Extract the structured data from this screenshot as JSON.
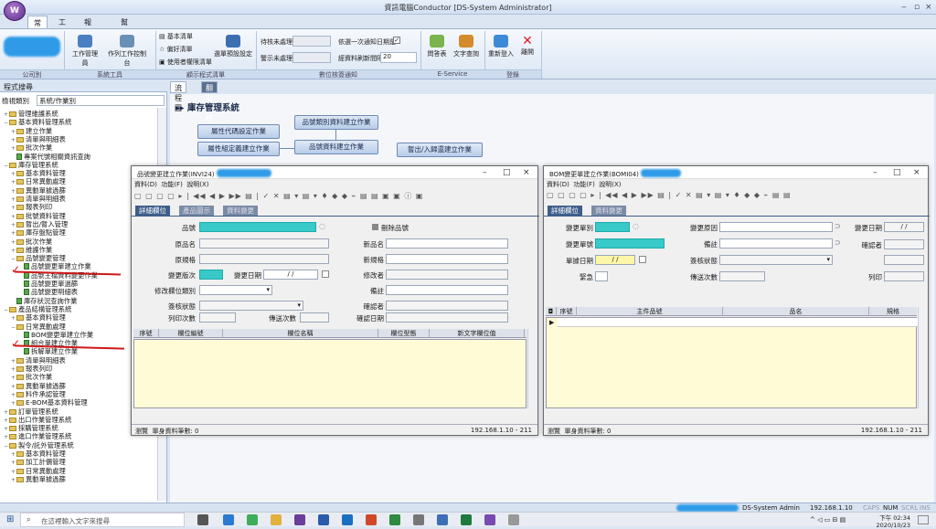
{
  "app": {
    "title": "資訊電腦Conductor [DS-System Administrator]",
    "orb": "W"
  },
  "ribbon": {
    "tabs": [
      "常用",
      "工具",
      "報告處理",
      "幫助"
    ],
    "groups": {
      "company": "公司別",
      "system_tools": "系統工具",
      "favorites": "顧示程式清單",
      "notify": "數位核簽通知",
      "eservice": "E-Service",
      "login": "登錄"
    },
    "buttons": {
      "work_manage": "工作管理員",
      "exec_console": "作列工作控制台",
      "basic_list": "基本清單",
      "my_favorites": "偏好清單",
      "user_auth": "使用者權限清單",
      "menu_setting": "選單預設設定",
      "approval_count": "待核未處理",
      "notify_count": "警示未處理",
      "reminder": "依選一次通知日期是",
      "refresh_interval": "經資料刷新間隔",
      "interval_value": "20",
      "q_and_a": "問答表",
      "doc_search": "文字查詢",
      "relogin": "重新登入",
      "close": "離開"
    }
  },
  "sidebar": {
    "title": "程式搜尋",
    "filter_label": "檢視類別",
    "filter_value": "系統/作業別",
    "tree": [
      {
        "t": "管理維護系統",
        "lvl": 1,
        "k": "fold",
        "e": "+"
      },
      {
        "t": "基本資料管理系統",
        "lvl": 1,
        "k": "fold",
        "e": "−"
      },
      {
        "t": "建立作業",
        "lvl": 2,
        "k": "fold",
        "e": "+"
      },
      {
        "t": "清單與明細表",
        "lvl": 2,
        "k": "fold",
        "e": "+"
      },
      {
        "t": "批次作業",
        "lvl": 2,
        "k": "fold",
        "e": "+"
      },
      {
        "t": "專案代號相關資訊查詢",
        "lvl": 2,
        "k": "doc",
        "e": ""
      },
      {
        "t": "庫存管理系統",
        "lvl": 1,
        "k": "fold",
        "e": "−"
      },
      {
        "t": "基本資料管理",
        "lvl": 2,
        "k": "fold",
        "e": "+"
      },
      {
        "t": "日常異動處理",
        "lvl": 2,
        "k": "fold",
        "e": "+"
      },
      {
        "t": "異動單據過篩",
        "lvl": 2,
        "k": "fold",
        "e": "+"
      },
      {
        "t": "清單與明細表",
        "lvl": 2,
        "k": "fold",
        "e": "+"
      },
      {
        "t": "報表列印",
        "lvl": 2,
        "k": "fold",
        "e": "+"
      },
      {
        "t": "批號資料管理",
        "lvl": 2,
        "k": "fold",
        "e": "+"
      },
      {
        "t": "暫出/暫入管理",
        "lvl": 2,
        "k": "fold",
        "e": "+"
      },
      {
        "t": "庫存盤點管理",
        "lvl": 2,
        "k": "fold",
        "e": "+"
      },
      {
        "t": "批次作業",
        "lvl": 2,
        "k": "fold",
        "e": "+"
      },
      {
        "t": "維護作業",
        "lvl": 2,
        "k": "fold",
        "e": "+"
      },
      {
        "t": "品號變更管理",
        "lvl": 2,
        "k": "fold",
        "e": "−"
      },
      {
        "t": "品號變更單建立作業",
        "lvl": 3,
        "k": "doc",
        "e": ""
      },
      {
        "t": "品號主檔資料變更作業",
        "lvl": 3,
        "k": "doc",
        "e": ""
      },
      {
        "t": "品號變更單過篩",
        "lvl": 3,
        "k": "doc",
        "e": ""
      },
      {
        "t": "品號變更明細表",
        "lvl": 3,
        "k": "doc",
        "e": ""
      },
      {
        "t": "庫存狀況查詢作業",
        "lvl": 2,
        "k": "doc",
        "e": ""
      },
      {
        "t": "產品結構管理系統",
        "lvl": 1,
        "k": "fold",
        "e": "−"
      },
      {
        "t": "基本資料管理",
        "lvl": 2,
        "k": "fold",
        "e": "+"
      },
      {
        "t": "日常異動處理",
        "lvl": 2,
        "k": "fold",
        "e": "−"
      },
      {
        "t": "BOM變更單建立作業",
        "lvl": 3,
        "k": "doc",
        "e": ""
      },
      {
        "t": "組合單建立作業",
        "lvl": 3,
        "k": "doc",
        "e": ""
      },
      {
        "t": "拆解單建立作業",
        "lvl": 3,
        "k": "doc",
        "e": ""
      },
      {
        "t": "清單與明細表",
        "lvl": 2,
        "k": "fold",
        "e": "+"
      },
      {
        "t": "報表列印",
        "lvl": 2,
        "k": "fold",
        "e": "+"
      },
      {
        "t": "批次作業",
        "lvl": 2,
        "k": "fold",
        "e": "+"
      },
      {
        "t": "異動單據過篩",
        "lvl": 2,
        "k": "fold",
        "e": "+"
      },
      {
        "t": "料件承認管理",
        "lvl": 2,
        "k": "fold",
        "e": "+"
      },
      {
        "t": "E-BOM基本資料管理",
        "lvl": 2,
        "k": "fold",
        "e": "+"
      },
      {
        "t": "訂單管理系統",
        "lvl": 1,
        "k": "fold",
        "e": "+"
      },
      {
        "t": "出口作業管理系統",
        "lvl": 1,
        "k": "fold",
        "e": "+"
      },
      {
        "t": "採購管理系統",
        "lvl": 1,
        "k": "fold",
        "e": "+"
      },
      {
        "t": "進口作業管理系統",
        "lvl": 1,
        "k": "fold",
        "e": "+"
      },
      {
        "t": "製令/託外管理系統",
        "lvl": 1,
        "k": "fold",
        "e": "−"
      },
      {
        "t": "基本資料管理",
        "lvl": 2,
        "k": "fold",
        "e": "+"
      },
      {
        "t": "加工計價管理",
        "lvl": 2,
        "k": "fold",
        "e": "+"
      },
      {
        "t": "日常異動處理",
        "lvl": 2,
        "k": "fold",
        "e": "+"
      },
      {
        "t": "異動單據過篩",
        "lvl": 2,
        "k": "fold",
        "e": "+"
      }
    ]
  },
  "main": {
    "tabs": [
      "流程圖",
      "翻寫檢核通知"
    ],
    "section_title": "庫存管理系統",
    "flow": [
      "屬性代碼設定作業",
      "品號類別資料建立作業",
      "屬性組定義建立作業",
      "品號資料建立作業",
      "暫出/入歸還建立作業"
    ]
  },
  "dlg1": {
    "title": "品號變更建立作業(INVI24)",
    "menu": [
      "資料(D)",
      "功能(F)",
      "說明(X)"
    ],
    "tabs": [
      "詳細欄位",
      "產品圖示",
      "資料變更"
    ],
    "labels": {
      "item": "品號",
      "delete_item": "刪除品號",
      "orig_name": "原品名",
      "new_name": "新品名",
      "orig_spec": "原規格",
      "new_spec": "新規格",
      "ver": "變更版次",
      "date": "變更日期",
      "date_val": "/   /",
      "modifier": "修改者",
      "mod_type": "修改欄位類別",
      "note": "備註",
      "sign": "簽核狀態",
      "confirmer": "確認者",
      "print_count": "列印次數",
      "send_count": "傳送次數",
      "confirm_date": "確認日期"
    },
    "grid_head": [
      "序號",
      "欄位編號",
      "欄位名稱",
      "欄位型態",
      "新文字欄位值"
    ],
    "status_left": "瀏覽",
    "status_count": "單身資料筆數: 0",
    "status_ip": "192.168.1.10 - 211"
  },
  "dlg2": {
    "title": "BOM變更單建立作業(BOMI04)",
    "menu": [
      "資料(D)",
      "功能(F)",
      "說明(X)"
    ],
    "tabs": [
      "詳細欄位",
      "資料變更"
    ],
    "labels": {
      "type": "變更單別",
      "reason": "變更原因",
      "date": "變更日期",
      "date_val": "/   /",
      "no": "變更單號",
      "note": "備註",
      "confirmer": "確認者",
      "doc_date": "單據日期",
      "doc_date_val": "/   /",
      "sign": "簽核狀態",
      "urgent": "緊急",
      "send_count": "傳送次數",
      "print": "列印"
    },
    "grid_head": [
      "序號",
      "主件品號",
      "品名",
      "規格"
    ],
    "status_left": "瀏覽",
    "status_count": "單身資料筆數: 0",
    "status_ip": "192.168.1.10 - 211"
  },
  "app_status": {
    "user": "DS-System Admin",
    "ip": "192.168.1.10",
    "caps": "CAPS",
    "num": "NUM",
    "scrl": "SCRL",
    "ins": "INS"
  },
  "taskbar": {
    "search": "在這裡輸入文字來搜尋",
    "time": "下午 02:34",
    "date": "2020/10/23"
  },
  "colors": {
    "accent": "#3e5d8a",
    "highlight": "#38c9c9",
    "annotation": "#d01818"
  }
}
